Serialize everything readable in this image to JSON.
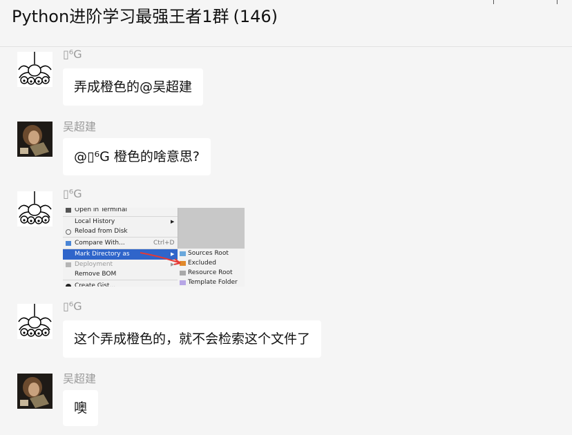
{
  "chat": {
    "title": "Python进阶学习最强王者1群",
    "member_count": "(146)"
  },
  "messages": [
    {
      "sender": "▯⁶G",
      "text": "弄成橙色的@吴超建",
      "avatar": "spider-avatar"
    },
    {
      "sender": "吴超建",
      "text": "@▯⁶G 橙色的啥意思?",
      "avatar": "photo-avatar"
    },
    {
      "sender": "▯⁶G",
      "type": "image",
      "avatar": "spider-avatar"
    },
    {
      "sender": "▯⁶G",
      "text": "这个弄成橙色的，就不会检索这个文件了",
      "avatar": "spider-avatar"
    },
    {
      "sender": "吴超建",
      "text": "噢",
      "avatar": "photo-avatar"
    }
  ],
  "screenshot_menu": {
    "items": [
      {
        "label": "Open in Terminal",
        "icon": "terminal-icon"
      },
      {
        "label": "Local History",
        "has_submenu": true
      },
      {
        "label": "Reload from Disk",
        "icon": "reload-icon"
      },
      {
        "label": "Compare With...",
        "shortcut": "Ctrl+D",
        "icon": "compare-icon"
      },
      {
        "label": "Mark Directory as",
        "has_submenu": true,
        "highlighted": true
      },
      {
        "label": "Deployment",
        "has_submenu": true,
        "disabled": true,
        "icon": "deployment-icon"
      },
      {
        "label": "Remove BOM"
      },
      {
        "label": "Create Gist...",
        "icon": "github-icon"
      }
    ],
    "submenu": [
      {
        "label": "Sources Root",
        "icon_color": "#6aa8dc"
      },
      {
        "label": "Excluded",
        "icon_color": "#e08a2c"
      },
      {
        "label": "Resource Root",
        "icon_color": "#a9a9a9"
      },
      {
        "label": "Template Folder",
        "icon_color": "#b7a6e6"
      }
    ],
    "annotation_arrow_color": "#e53935"
  }
}
